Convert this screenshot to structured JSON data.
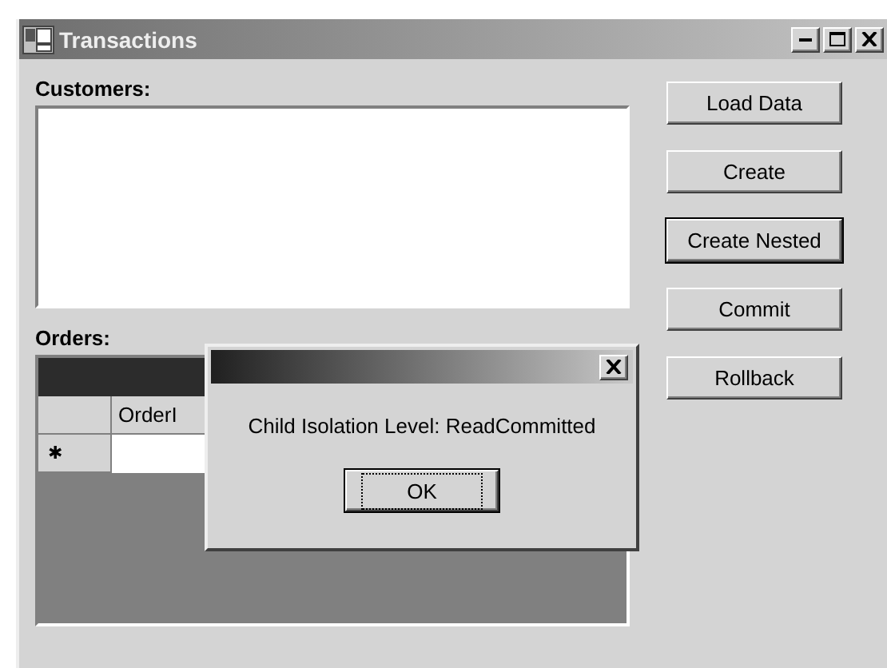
{
  "window": {
    "title": "Transactions"
  },
  "customers": {
    "label": "Customers:"
  },
  "orders": {
    "label": "Orders:",
    "columns": [
      "OrderI"
    ],
    "new_row_marker": "✱"
  },
  "buttons": [
    {
      "label": "Load Data",
      "default": false
    },
    {
      "label": "Create",
      "default": false
    },
    {
      "label": "Create Nested",
      "default": true
    },
    {
      "label": "Commit",
      "default": false
    },
    {
      "label": "Rollback",
      "default": false
    }
  ],
  "dialog": {
    "message": "Child Isolation Level: ReadCommitted",
    "ok_label": "OK"
  }
}
